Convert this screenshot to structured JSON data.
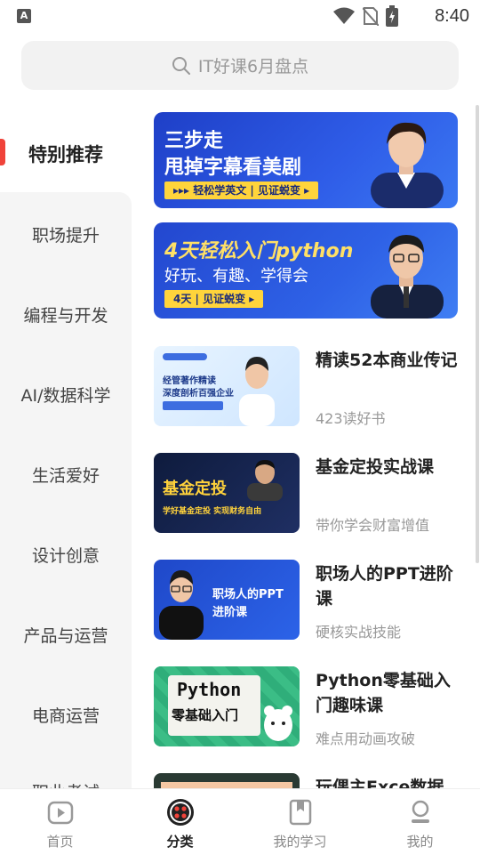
{
  "status_bar": {
    "app_badge": "A",
    "time": "8:40"
  },
  "search": {
    "placeholder": "IT好课6月盘点"
  },
  "sidebar": {
    "items": [
      {
        "label": "特别推荐"
      },
      {
        "label": "职场提升"
      },
      {
        "label": "编程与开发"
      },
      {
        "label": "AI/数据科学"
      },
      {
        "label": "生活爱好"
      },
      {
        "label": "设计创意"
      },
      {
        "label": "产品与运营"
      },
      {
        "label": "电商运营"
      },
      {
        "label": "职业考试"
      }
    ]
  },
  "banners": [
    {
      "title_line1": "三步走",
      "title_line2": "甩掉字幕看美剧",
      "tag": "▸▸▸  轻松学英文 | 见证蜕变 ▸"
    },
    {
      "title_line1": "4天轻松入门python",
      "title_line2": "好玩、有趣、学得会",
      "tag": "4天 | 见证蜕变 ▸"
    }
  ],
  "courses": [
    {
      "title": "精读52本商业传记",
      "subtitle": "423读好书",
      "thumb_text1": "经管著作精读",
      "thumb_text2": "深度剖析百强企业"
    },
    {
      "title": "基金定投实战课",
      "subtitle": "带你学会财富增值",
      "thumb_text1": "基金定投",
      "thumb_text2": "学好基金定投 实现财务自由"
    },
    {
      "title": "职场人的PPT进阶课",
      "subtitle": "硬核实战技能",
      "thumb_text1": "职场人的PPT",
      "thumb_text2": "进阶课"
    },
    {
      "title": "Python零基础入门趣味课",
      "subtitle": "难点用动画攻破",
      "thumb_text1": "Python",
      "thumb_text2": "零基础入门"
    },
    {
      "title": "玩偶主Exce数据",
      "subtitle": ""
    }
  ],
  "bottom_nav": [
    {
      "label": "首页"
    },
    {
      "label": "分类"
    },
    {
      "label": "我的学习"
    },
    {
      "label": "我的"
    }
  ],
  "colors": {
    "accent": "#f0433a",
    "banner_blue": "#2f5de8",
    "tag_yellow": "#ffd43b"
  }
}
